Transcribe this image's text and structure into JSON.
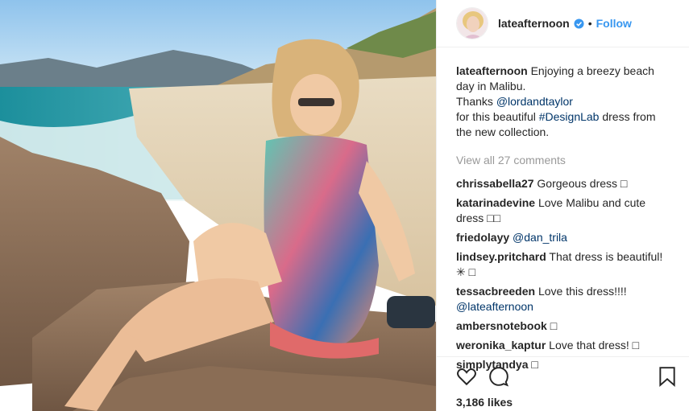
{
  "post": {
    "username": "lateafternoon",
    "dot": "•",
    "follow_label": "Follow",
    "caption_user": "lateafternoon",
    "caption_1": "Enjoying a breezy beach day in Malibu.",
    "caption_thanks": "Thanks",
    "caption_mention": "@lordandtaylor",
    "caption_for": "for this beautiful",
    "caption_hashtag": "#DesignLab",
    "caption_rest": "dress from the new collection.",
    "view_all": "View all 27 comments",
    "likes": "3,186 likes"
  },
  "comments": [
    {
      "user": "chrissabella27",
      "text": "Gorgeous dress □"
    },
    {
      "user": "katarinadevine",
      "text": "Love Malibu and cute dress □□"
    },
    {
      "user": "friedolayy",
      "text": "",
      "mention": "@dan_trila"
    },
    {
      "user": "lindsey.pritchard",
      "text": "That dress is beautiful! ✳ □"
    },
    {
      "user": "tessacbreeden",
      "text": "Love this dress!!!!",
      "mention": "@lateafternoon"
    },
    {
      "user": "ambersnotebook",
      "text": "□"
    },
    {
      "user": "weronika_kaptur",
      "text": "Love that dress! □"
    },
    {
      "user": "simplytandya",
      "text": "□"
    }
  ],
  "icons": [
    "heart-icon",
    "comment-icon",
    "bookmark-icon",
    "verified-icon"
  ],
  "colors": {
    "link": "#003569",
    "follow": "#3897f0",
    "muted": "#999999",
    "verified": "#3897f0"
  }
}
